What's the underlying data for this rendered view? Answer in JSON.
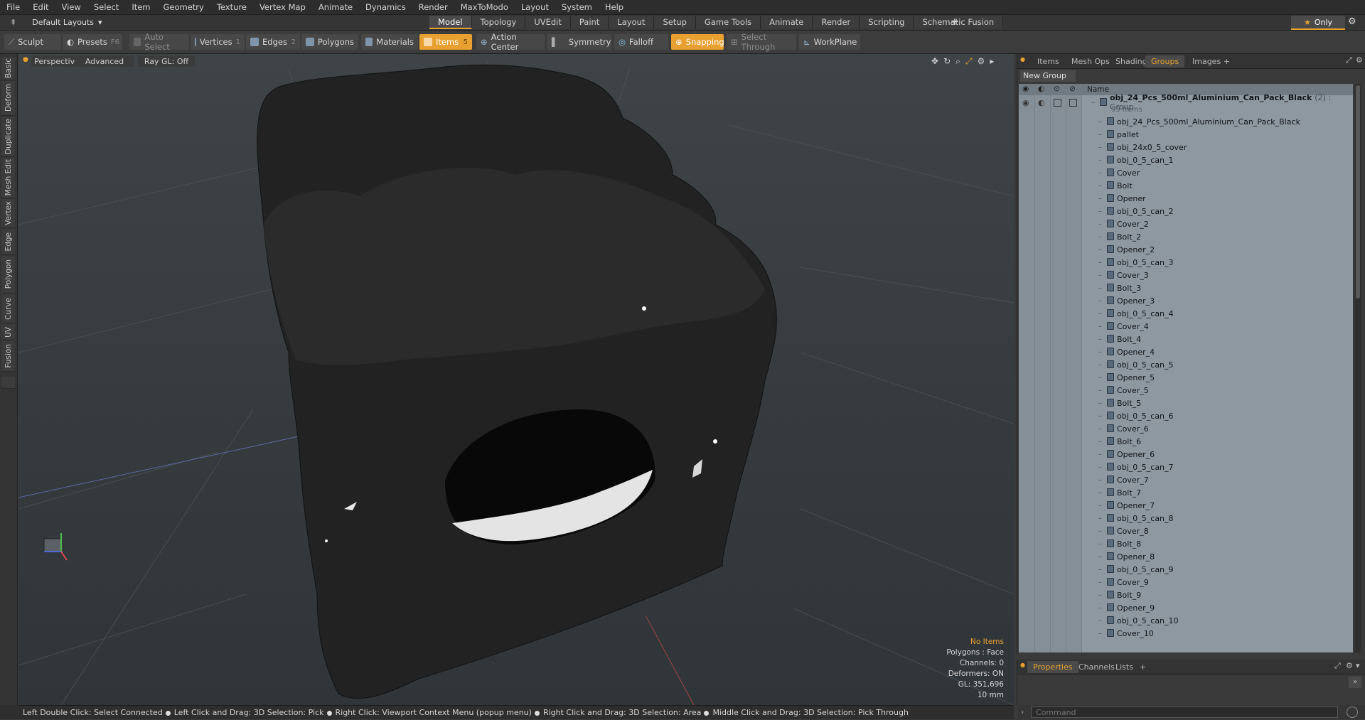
{
  "menu": [
    "File",
    "Edit",
    "View",
    "Select",
    "Item",
    "Geometry",
    "Texture",
    "Vertex Map",
    "Animate",
    "Dynamics",
    "Render",
    "MaxToModo",
    "Layout",
    "System",
    "Help"
  ],
  "layout_selector": "Default Layouts",
  "layout_tabs": [
    "Model",
    "Topology",
    "UVEdit",
    "Paint",
    "Layout",
    "Setup",
    "Game Tools",
    "Animate",
    "Render",
    "Scripting",
    "Schematic Fusion"
  ],
  "layout_tabs_add": "+",
  "only_label": "Only",
  "toolbar": {
    "sculpt": "Sculpt",
    "presets": "Presets",
    "presets_key": "F6",
    "auto_select": "Auto Select",
    "vertices": "Vertices",
    "vertices_num": "1",
    "edges": "Edges",
    "edges_num": "2",
    "polygons": "Polygons",
    "materials": "Materials",
    "items": "Items",
    "items_num": "5",
    "action_center": "Action Center",
    "symmetry": "Symmetry",
    "falloff": "Falloff",
    "snapping": "Snapping",
    "select_through": "Select Through",
    "workplane": "WorkPlane"
  },
  "left_tabs": [
    "Basic",
    "Deform",
    "Duplicate",
    "Mesh Edit",
    "Vertex",
    "Edge",
    "Polygon",
    "Curve",
    "UV",
    "Fusion"
  ],
  "viewport": {
    "view": "Perspective",
    "shading": "Advanced",
    "raygl": "Ray GL: Off",
    "info": {
      "items": "No Items",
      "polygons": "Polygons : Face",
      "channels": "Channels: 0",
      "deformers": "Deformers: ON",
      "gl": "GL: 351,696",
      "unit": "10 mm"
    }
  },
  "right_tabs": [
    "Items",
    "Mesh Ops",
    "Shading",
    "Groups",
    "Images"
  ],
  "right_tabs_add": "+",
  "new_group": "New Group",
  "tree_header": "Name",
  "tree_group": {
    "name": "obj_24_Pcs_500ml_Aluminium_Can_Pack_Black",
    "count": "(2)",
    "type": ": Group",
    "items_count": "99 Items"
  },
  "tree_items": [
    "obj_24_Pcs_500ml_Aluminium_Can_Pack_Black",
    "pallet",
    "obj_24x0_5_cover",
    "obj_0_5_can_1",
    "Cover",
    "Bolt",
    "Opener",
    "obj_0_5_can_2",
    "Cover_2",
    "Bolt_2",
    "Opener_2",
    "obj_0_5_can_3",
    "Cover_3",
    "Bolt_3",
    "Opener_3",
    "obj_0_5_can_4",
    "Cover_4",
    "Bolt_4",
    "Opener_4",
    "obj_0_5_can_5",
    "Opener_5",
    "Cover_5",
    "Bolt_5",
    "obj_0_5_can_6",
    "Cover_6",
    "Bolt_6",
    "Opener_6",
    "obj_0_5_can_7",
    "Cover_7",
    "Bolt_7",
    "Opener_7",
    "obj_0_5_can_8",
    "Cover_8",
    "Bolt_8",
    "Opener_8",
    "obj_0_5_can_9",
    "Cover_9",
    "Bolt_9",
    "Opener_9",
    "obj_0_5_can_10",
    "Cover_10"
  ],
  "props_tabs": [
    "Properties",
    "Channels",
    "Lists"
  ],
  "props_tabs_add": "+",
  "command_placeholder": "Command",
  "status_items": [
    "Left Double Click: Select Connected",
    "Left Click and Drag: 3D Selection: Pick",
    "Right Click: Viewport Context Menu (popup menu)",
    "Right Click and Drag: 3D Selection: Area",
    "Middle Click and Drag: 3D Selection: Pick Through"
  ],
  "colors": {
    "accent": "#e8a030",
    "tree_bg": "#8d98a1"
  }
}
